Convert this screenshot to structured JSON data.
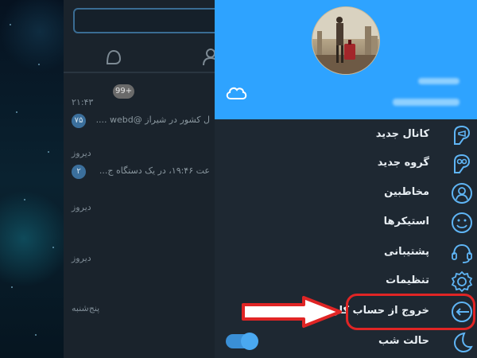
{
  "chat_list": {
    "unread_badge": "99+",
    "rows": [
      {
        "time": "۲۱:۴۳",
        "preview": "ل کشور در شیراز @webd ....",
        "count": "۷۵"
      },
      {
        "time": "دیروز",
        "preview": "عت ۱۹:۴۶، در یک دستگاه ج...",
        "count": "۲"
      },
      {
        "time": "دیروز"
      },
      {
        "time": "دیروز"
      },
      {
        "time": "پنج‌شنبه"
      }
    ]
  },
  "drawer": {
    "menu": [
      {
        "label": "کانال جدید",
        "icon": "channel-icon"
      },
      {
        "label": "گروه جدید",
        "icon": "group-icon"
      },
      {
        "label": "مخاطبین",
        "icon": "contacts-icon"
      },
      {
        "label": "استیکرها",
        "icon": "sticker-icon"
      },
      {
        "label": "پشتیبانی",
        "icon": "support-icon"
      },
      {
        "label": "تنظیمات",
        "icon": "settings-icon"
      },
      {
        "label": "خروج از حساب کاربری",
        "icon": "logout-icon"
      },
      {
        "label": "حالت شب",
        "icon": "night-mode-icon"
      }
    ]
  },
  "colors": {
    "header": "#2ea3ff",
    "icon_accent": "#5fb5f5",
    "highlight": "#e02525"
  }
}
